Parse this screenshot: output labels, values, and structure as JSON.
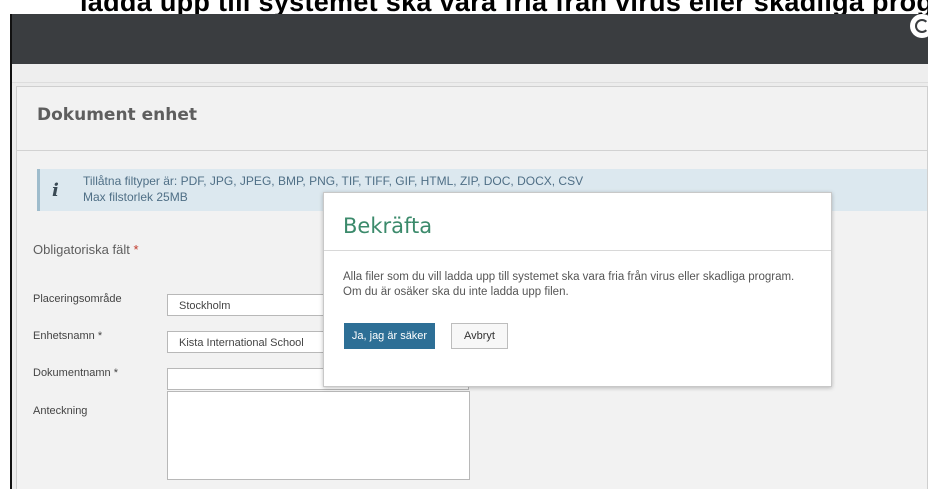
{
  "caption": "ladda upp till systemet ska vara fria från virus eller skadliga program",
  "header": {
    "help_icon": "help-icon"
  },
  "page": {
    "title": "Dokument enhet",
    "info": {
      "icon": "info-icon",
      "line1": "Tillåtna filtyper är: PDF, JPG, JPEG, BMP, PNG, TIF, TIFF, GIF, HTML, ZIP, DOC, DOCX, CSV",
      "line2": "Max filstorlek 25MB"
    },
    "required_label": "Obligatoriska fält",
    "required_star": "*"
  },
  "form": {
    "placering_label": "Placeringsområde",
    "placering_value": "Stockholm",
    "enhet_label": "Enhetsnamn *",
    "enhet_value": "Kista International School",
    "dokument_label": "Dokumentnamn *",
    "dokument_value": "",
    "anteckning_label": "Anteckning"
  },
  "modal": {
    "title": "Bekräfta",
    "body": "Alla filer som du vill ladda upp till systemet ska vara fria från virus eller skadliga program. Om du är osäker ska du inte ladda upp filen.",
    "confirm": "Ja, jag är säker",
    "cancel": "Avbryt"
  }
}
